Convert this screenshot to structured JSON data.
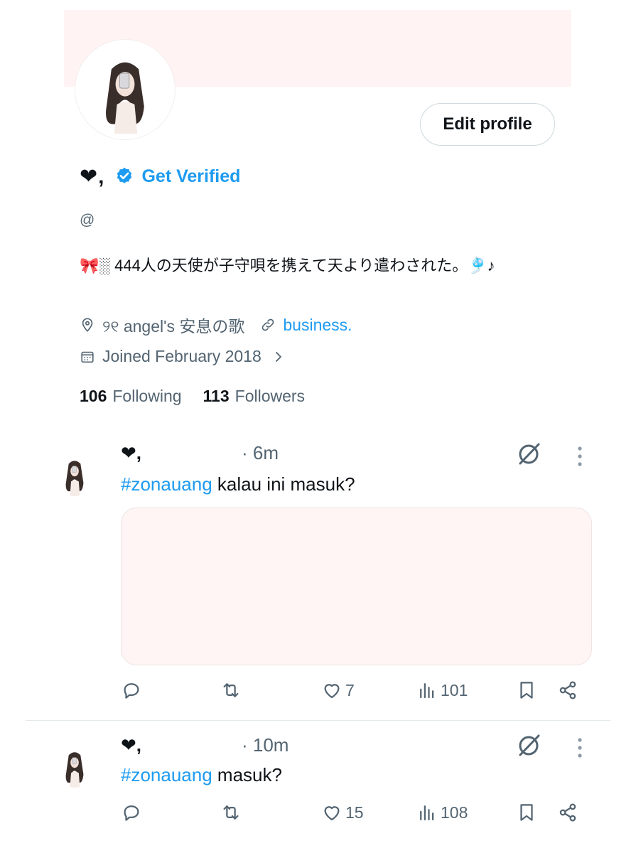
{
  "profile": {
    "display_name": "❤,",
    "get_verified": "Get Verified",
    "handle": "@",
    "bio": "🎀░ 444人の天使が子守唄を携えて天より遣わされた。🎐♪",
    "location": "୨୧ angel's 安息の歌",
    "website": "business.",
    "joined": "Joined February 2018",
    "edit_button": "Edit profile",
    "following_count": "106",
    "following_label": "Following",
    "followers_count": "113",
    "followers_label": "Followers"
  },
  "tweets": [
    {
      "name": "❤,",
      "time": "· 6m",
      "hashtag": "#zonauang",
      "text": " kalau ini masuk?",
      "likes": "7",
      "views": "101"
    },
    {
      "name": "❤,",
      "time": "· 10m",
      "hashtag": "#zonauang",
      "text": " masuk?",
      "likes": "15",
      "views": "108"
    }
  ],
  "colors": {
    "accent": "#1d9bf0",
    "secondary_text": "#536471",
    "banner": "#fff3f3"
  },
  "icons": [
    "location-icon",
    "link-icon",
    "calendar-icon",
    "reply-icon",
    "retweet-icon",
    "like-icon",
    "views-icon",
    "bookmark-icon",
    "share-icon",
    "grok-icon",
    "more-icon",
    "verified-badge-icon"
  ]
}
